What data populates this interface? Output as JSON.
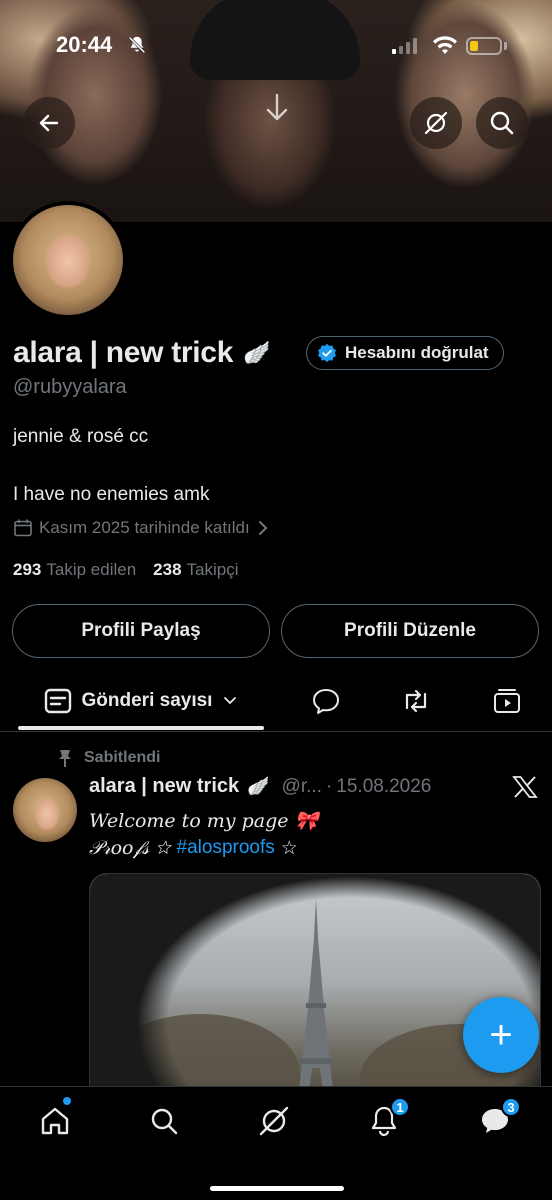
{
  "status_bar": {
    "time": "20:44"
  },
  "profile": {
    "display_name": "alara | new trick",
    "name_emoji": "🪽",
    "verify_label": "Hesabını doğrulat",
    "handle": "@rubyyalara",
    "bio_line1": "jennie & rosé cc",
    "bio_line2": "I have no enemies amk",
    "joined": "Kasım 2025 tarihinde katıldı",
    "following_count": "293",
    "following_label": "Takip edilen",
    "followers_count": "238",
    "followers_label": "Takipçi",
    "share_button": "Profili Paylaş",
    "edit_button": "Profili Düzenle"
  },
  "tabs": {
    "posts_label": "Gönderi sayısı"
  },
  "pinned_post": {
    "pinned_label": "Sabitlendi",
    "author_name": "alara | new trick",
    "author_emoji": "🪽",
    "handle_truncated": "@r...",
    "separator": "·",
    "date": "15.08.2026",
    "line1": "Welcome to my page 🎀",
    "line2_prefix": "𝒫𝓇𝑜𝑜𝒻𝓈 ☆",
    "hashtag": "#alosproofs",
    "line2_suffix": "☆"
  },
  "fab": {
    "label": "+"
  },
  "bottom_nav": {
    "notifications_badge": "1",
    "messages_badge": "3"
  },
  "colors": {
    "accent": "#1d9bf0",
    "background": "#000000",
    "secondary_text": "#71767b",
    "border": "#536471"
  },
  "icons": {
    "back": "arrow-left-icon",
    "download": "arrow-down-icon",
    "grok": "grok-icon",
    "search": "search-icon",
    "verified": "verified-check-icon",
    "calendar": "calendar-icon",
    "posts_tab": "posts-icon",
    "replies_tab": "speech-bubble-icon",
    "reposts_tab": "repost-icon",
    "media_tab": "media-icon",
    "pin": "pin-icon",
    "x_logo": "x-logo-icon",
    "home": "home-icon",
    "notifications": "bell-icon",
    "messages": "messages-icon"
  }
}
